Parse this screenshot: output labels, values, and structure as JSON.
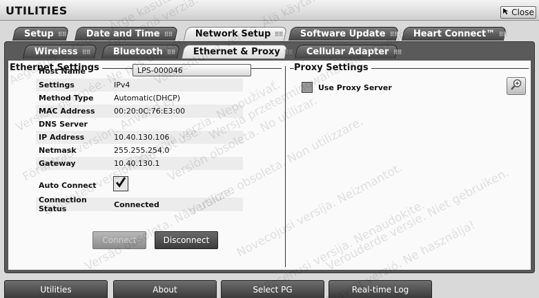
{
  "app": {
    "title": "UTILITIES",
    "close_label": "Close"
  },
  "tabs_primary": [
    {
      "label": "Setup"
    },
    {
      "label": "Date and Time"
    },
    {
      "label": "Network Setup"
    },
    {
      "label": "Software Update"
    },
    {
      "label": "Heart Connect™"
    }
  ],
  "tabs_secondary": [
    {
      "label": "Wireless"
    },
    {
      "label": "Bluetooth"
    },
    {
      "label": "Ethernet & Proxy"
    },
    {
      "label": "Cellular Adapter"
    }
  ],
  "ethernet": {
    "title": "Ethernet Settings",
    "host_name_label": "Host Name",
    "host_name_value": "LPS-000046",
    "rows": [
      {
        "label": "Settings",
        "value": "IPv4"
      },
      {
        "label": "Method Type",
        "value": "Automatic(DHCP)"
      },
      {
        "label": "MAC Address",
        "value": "00:20:0C:76:E3:00"
      },
      {
        "label": "DNS Server",
        "value": ""
      },
      {
        "label": "IP Address",
        "value": "10.40.130.106"
      },
      {
        "label": "Netmask",
        "value": "255.255.254.0"
      },
      {
        "label": "Gateway",
        "value": "10.40.130.1"
      }
    ],
    "auto_connect_label": "Auto Connect",
    "auto_connect_checked": true,
    "connection_status_label": "Connection Status",
    "connection_status_value": "Connected",
    "connect_label": "Connect",
    "disconnect_label": "Disconnect"
  },
  "proxy": {
    "title": "Proxy Settings",
    "use_proxy_label": "Use Proxy Server",
    "use_proxy_checked": false,
    "edit_icon": "magnifier-plus-icon"
  },
  "bottom_nav": [
    {
      "label": "Utilities"
    },
    {
      "label": "About"
    },
    {
      "label": "Select PG"
    },
    {
      "label": "Real-time Log"
    }
  ],
  "watermark": [
    "Version périmée. Ne pas utiliser.",
    "Outdated version. Do not use.",
    "Versão obsoleta. Não utilize.",
    "Aegunud versioon. Ärge kasutage.",
    "Zastaraná verzia. Nepoužívať.",
    "Versione obsoleta. Non utilizzare.",
    "Novecojusi versija. Neizmantot.",
    "Pasenusi versija. Nenaudokite.",
    "Elavult verzió. Ne használja!",
    "Verouderde versie. Niet gebruiken.",
    "Versión obsoleta. No utilizar.",
    "Zastarelá verzia. Nepoužívať.",
    "Wersja przeterminowana. Nie używać.",
    "Vanhentunut versio. Älä käytä.",
    "Föråldrad version. Använd ej."
  ],
  "colors": {
    "tab_dark": "#4a4a4a",
    "tab_active": "#e8e8e8",
    "panel_bg": "#fafafa",
    "frame_dark": "#5a5a5a"
  }
}
